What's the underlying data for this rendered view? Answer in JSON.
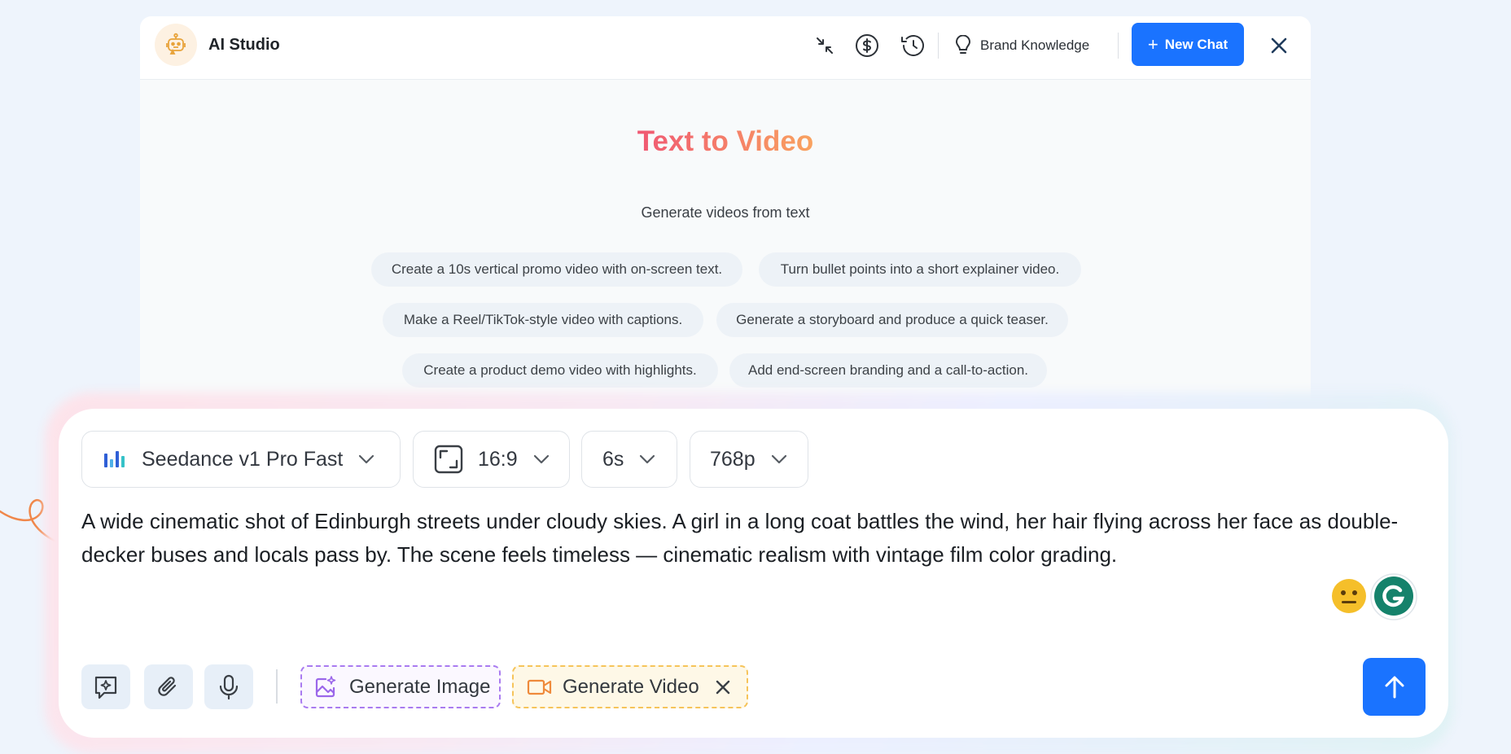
{
  "header": {
    "title": "AI Studio",
    "brand_knowledge_label": "Brand Knowledge",
    "new_chat_label": "New Chat"
  },
  "hero": {
    "title": "Text to Video",
    "subtitle": "Generate videos from text"
  },
  "suggestions": [
    "Create a 10s vertical promo video with on-screen text.",
    "Turn bullet points into a short explainer video.",
    "Make a Reel/TikTok-style video with captions.",
    "Generate a storyboard and produce a quick teaser.",
    "Create a product demo video with highlights.",
    "Add end-screen branding and a call-to-action."
  ],
  "composer": {
    "model": "Seedance v1 Pro Fast",
    "aspect_ratio": "16:9",
    "duration": "6s",
    "resolution": "768p",
    "prompt": "A wide cinematic shot of Edinburgh streets under cloudy skies. A girl in a long coat battles the wind, her hair flying across her face as double-decker buses and locals pass by. The scene feels timeless — cinematic realism with vintage film color grading.",
    "generate_image_label": "Generate Image",
    "generate_video_label": "Generate Video"
  },
  "colors": {
    "accent": "#1a73ff",
    "image_mode": "#a97bf0",
    "video_mode": "#f6c45a",
    "title_gradient_start": "#f05873",
    "title_gradient_end": "#f9a25f"
  }
}
